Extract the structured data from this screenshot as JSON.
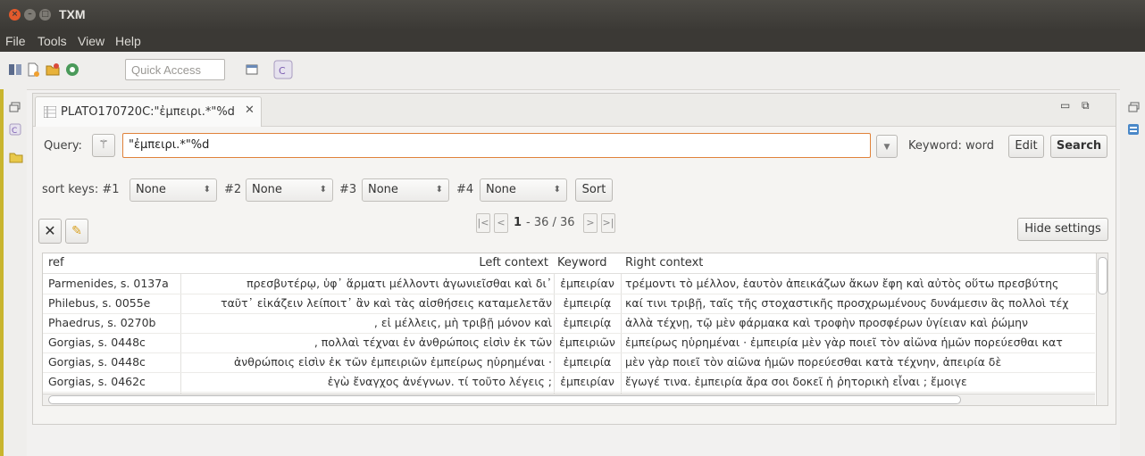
{
  "window": {
    "title": "TXM"
  },
  "menu": [
    "File",
    "Tools",
    "View",
    "Help"
  ],
  "toolbar": {
    "quick_access_placeholder": "Quick Access"
  },
  "tab": {
    "label": "PLATO170720C:\"ἐμπειρι.*\"%d"
  },
  "query": {
    "label": "Query:",
    "value": "\"ἐμπειρι.*\"%d",
    "keyword_label": "Keyword: word",
    "edit_label": "Edit",
    "search_label": "Search"
  },
  "sort": {
    "label": "sort keys: #1",
    "k2": "#2",
    "k3": "#3",
    "k4": "#4",
    "values": [
      "None",
      "None",
      "None",
      "None"
    ],
    "sort_label": "Sort"
  },
  "pager": {
    "first": "|<",
    "prev": "<",
    "page": "1",
    "range": "- 36 / 36",
    "next": ">",
    "last": ">|",
    "hide_label": "Hide settings"
  },
  "table": {
    "headers": [
      "ref",
      "Left context",
      "Keyword",
      "Right context"
    ],
    "rows": [
      {
        "ref": "Parmenides, s. 0137a",
        "left": "πρεσβυτέρῳ, ὑφ᾽ ἅρματι μέλλοντι ἀγωνιεῖσθαι καὶ δι᾽",
        "kw": "ἐμπειρίαν",
        "right": "τρέμοντι τὸ μέλλον, ἑαυτὸν ἀπεικάζων ἄκων ἔφη καὶ αὐτὸς οὕτω πρεσβύτης"
      },
      {
        "ref": "Philebus, s. 0055e",
        "left": "ταῦτ᾽ εἰκάζειν λείποιτ᾽ ἂν καὶ τὰς αἰσθήσεις καταμελετᾶν",
        "kw": "ἐμπειρίᾳ",
        "right": "καί τινι τριβῇ, ταῖς τῆς στοχαστικῆς προσχρωμένους δυνάμεσιν ἃς πολλοὶ τέχ"
      },
      {
        "ref": "Phaedrus, s. 0270b",
        "left": ", εἰ μέλλεις, μὴ τριβῇ μόνον καὶ",
        "kw": "ἐμπειρίᾳ",
        "right": "ἀλλὰ τέχνῃ, τῷ μὲν φάρμακα καὶ τροφὴν προσφέρων ὑγίειαν καὶ ῥώμην"
      },
      {
        "ref": "Gorgias, s. 0448c",
        "left": ", πολλαὶ τέχναι ἐν ἀνθρώποις εἰσὶν ἐκ τῶν",
        "kw": "ἐμπειριῶν",
        "right": "ἐμπείρως ηὑρημέναι · ἐμπειρία μὲν γὰρ ποιεῖ τὸν αἰῶνα ἡμῶν πορεύεσθαι κατ"
      },
      {
        "ref": "Gorgias, s. 0448c",
        "left": "ἀνθρώποις εἰσὶν ἐκ τῶν ἐμπειριῶν ἐμπείρως ηὑρημέναι ·",
        "kw": "ἐμπειρία",
        "right": "μὲν γὰρ ποιεῖ τὸν αἰῶνα ἡμῶν πορεύεσθαι κατὰ τέχνην, ἀπειρία δὲ"
      },
      {
        "ref": "Gorgias, s. 0462c",
        "left": "ἐγὼ ἔναγχος ἀνέγνων. τί τοῦτο λέγεις ;",
        "kw": "ἐμπειρίαν",
        "right": "ἔγωγέ τινα. ἐμπειρία ἄρα σοι δοκεῖ ἡ ῥητορικὴ εἶναι ; ἔμοιγε"
      }
    ]
  },
  "colors": {
    "accent": "#e0823a",
    "titlebar": "#3b3935",
    "close": "#e35a2c"
  }
}
